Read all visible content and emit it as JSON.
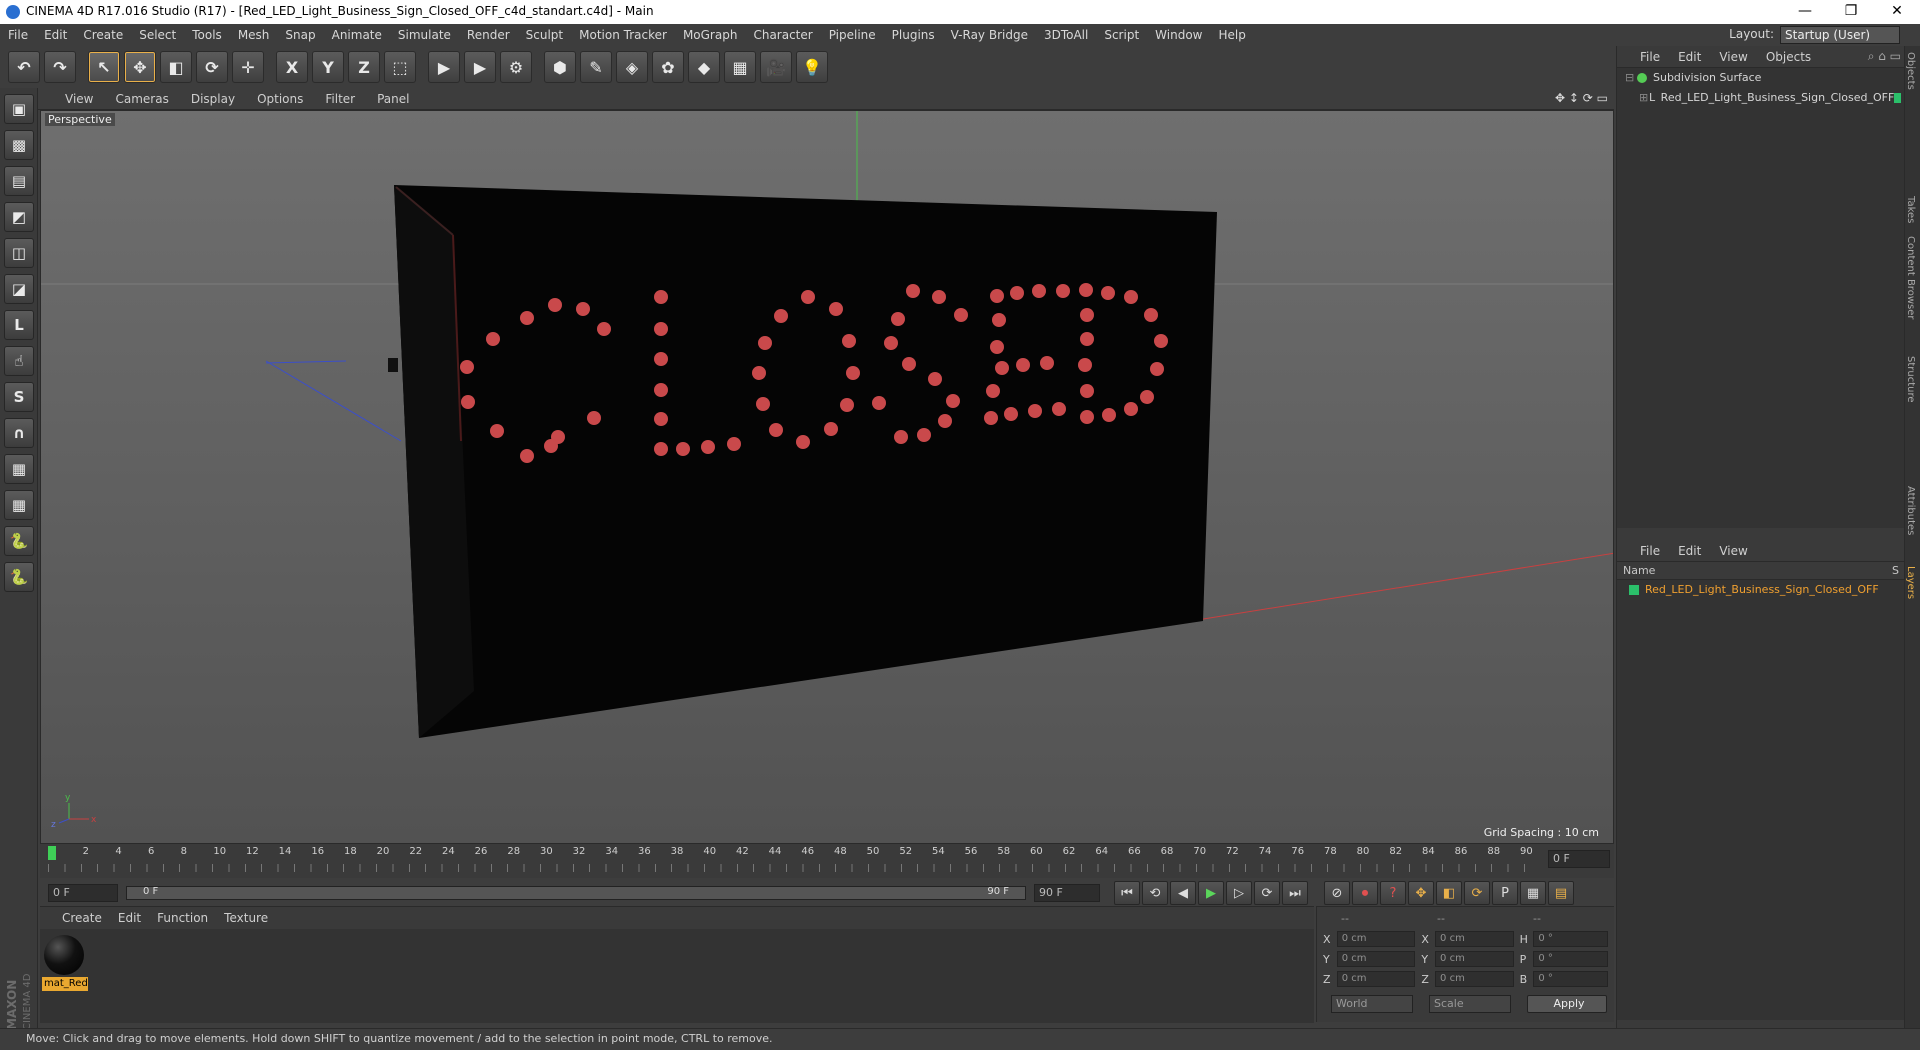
{
  "window": {
    "title": "CINEMA 4D R17.016 Studio (R17) - [Red_LED_Light_Business_Sign_Closed_OFF_c4d_standart.c4d] - Main",
    "controls": [
      "—",
      "❐",
      "✕"
    ]
  },
  "menubar": {
    "items": [
      "File",
      "Edit",
      "Create",
      "Select",
      "Tools",
      "Mesh",
      "Snap",
      "Animate",
      "Simulate",
      "Render",
      "Sculpt",
      "Motion Tracker",
      "MoGraph",
      "Character",
      "Pipeline",
      "Plugins",
      "V-Ray Bridge",
      "3DToAll",
      "Script",
      "Window",
      "Help"
    ],
    "layout_label": "Layout:",
    "layout_value": "Startup (User)"
  },
  "toolbar": {
    "buttons": [
      {
        "name": "undo-button",
        "glyph": "↶"
      },
      {
        "name": "redo-button",
        "glyph": "↷"
      },
      {
        "name": "select-tool-button",
        "glyph": "↖",
        "active": true
      },
      {
        "name": "move-tool-button",
        "glyph": "✥",
        "active": true
      },
      {
        "name": "scale-tool-button",
        "glyph": "◧"
      },
      {
        "name": "rotate-tool-button",
        "glyph": "⟳"
      },
      {
        "name": "recent-tool-button",
        "glyph": "✛"
      },
      {
        "name": "x-axis-button",
        "glyph": "X"
      },
      {
        "name": "y-axis-button",
        "glyph": "Y"
      },
      {
        "name": "z-axis-button",
        "glyph": "Z"
      },
      {
        "name": "coordinate-system-button",
        "glyph": "⬚"
      },
      {
        "name": "render-view-button",
        "glyph": "▶"
      },
      {
        "name": "render-picture-viewer-button",
        "glyph": "▶"
      },
      {
        "name": "render-settings-button",
        "glyph": "⚙"
      },
      {
        "name": "cube-button",
        "glyph": "⬢"
      },
      {
        "name": "spline-pen-button",
        "glyph": "✎"
      },
      {
        "name": "subdivision-surface-button",
        "glyph": "◈"
      },
      {
        "name": "cloner-button",
        "glyph": "✿"
      },
      {
        "name": "deformer-button",
        "glyph": "◆"
      },
      {
        "name": "floor-button",
        "glyph": "▦"
      },
      {
        "name": "camera-button",
        "glyph": "🎥"
      },
      {
        "name": "light-button",
        "glyph": "💡"
      }
    ]
  },
  "left_tools": [
    "▣",
    "▩",
    "▤",
    "◩",
    "◫",
    "◪",
    "L",
    "☝",
    "S",
    "∩",
    "▦",
    "▦",
    "🐍",
    "🐍"
  ],
  "viewport": {
    "menu": [
      "View",
      "Cameras",
      "Display",
      "Options",
      "Filter",
      "Panel"
    ],
    "label": "Perspective",
    "grid_spacing": "Grid Spacing : 10 cm",
    "sign_text": "CLOSED"
  },
  "timeline": {
    "ticks": [
      "0",
      "2",
      "4",
      "6",
      "8",
      "10",
      "12",
      "14",
      "16",
      "18",
      "20",
      "22",
      "24",
      "26",
      "28",
      "30",
      "32",
      "34",
      "36",
      "38",
      "40",
      "42",
      "44",
      "46",
      "48",
      "50",
      "52",
      "54",
      "56",
      "58",
      "60",
      "62",
      "64",
      "66",
      "68",
      "70",
      "72",
      "74",
      "76",
      "78",
      "80",
      "82",
      "84",
      "86",
      "88",
      "90"
    ],
    "current_frame": "0 F"
  },
  "playback": {
    "start_field": "0 F",
    "range_start": "0 F",
    "range_end": "90 F",
    "end_field": "90 F",
    "buttons": [
      "⏮",
      "⟲",
      "◀",
      "▶",
      "▷",
      "⟳",
      "⏭"
    ],
    "right_buttons": [
      "⊘",
      "⏺",
      "?",
      "✥",
      "◧",
      "⟳",
      "P",
      "▦",
      "▤"
    ]
  },
  "materials": {
    "menu": [
      "Create",
      "Edit",
      "Function",
      "Texture"
    ],
    "items": [
      {
        "label": "mat_Red"
      }
    ]
  },
  "coords": {
    "headers": [
      "--",
      "--",
      "--"
    ],
    "rows": [
      {
        "a": "X",
        "av": "0 cm",
        "b": "X",
        "bv": "0 cm",
        "c": "H",
        "cv": "0 °"
      },
      {
        "a": "Y",
        "av": "0 cm",
        "b": "Y",
        "bv": "0 cm",
        "c": "P",
        "cv": "0 °"
      },
      {
        "a": "Z",
        "av": "0 cm",
        "b": "Z",
        "bv": "0 cm",
        "c": "B",
        "cv": "0 °"
      }
    ],
    "world": "World",
    "scale": "Scale",
    "apply": "Apply"
  },
  "object_manager": {
    "menu": [
      "File",
      "Edit",
      "View",
      "Objects"
    ],
    "objects": [
      {
        "name": "Subdivision Surface",
        "color": "#55cc55"
      },
      {
        "name": "Red_LED_Light_Business_Sign_Closed_OFF",
        "color": "#cccccc"
      }
    ]
  },
  "layer_manager": {
    "menu": [
      "File",
      "Edit",
      "View"
    ],
    "column_name": "Name",
    "column_s": "S",
    "rows": [
      {
        "name": "Red_LED_Light_Business_Sign_Closed_OFF",
        "color": "#2bbf6a"
      }
    ]
  },
  "side_tabs": [
    "Objects",
    "Takes",
    "Content Browser",
    "Structure",
    "Attributes",
    "Layers"
  ],
  "logo": {
    "brand": "MAXON",
    "product": "CINEMA 4D"
  },
  "statusbar": {
    "text": "Move: Click and drag to move elements. Hold down SHIFT to quantize movement / add to the selection in point mode, CTRL to remove."
  },
  "colors": {
    "accent": "#e9b04a",
    "led": "#c9494b",
    "selected_text": "#f0a030"
  }
}
